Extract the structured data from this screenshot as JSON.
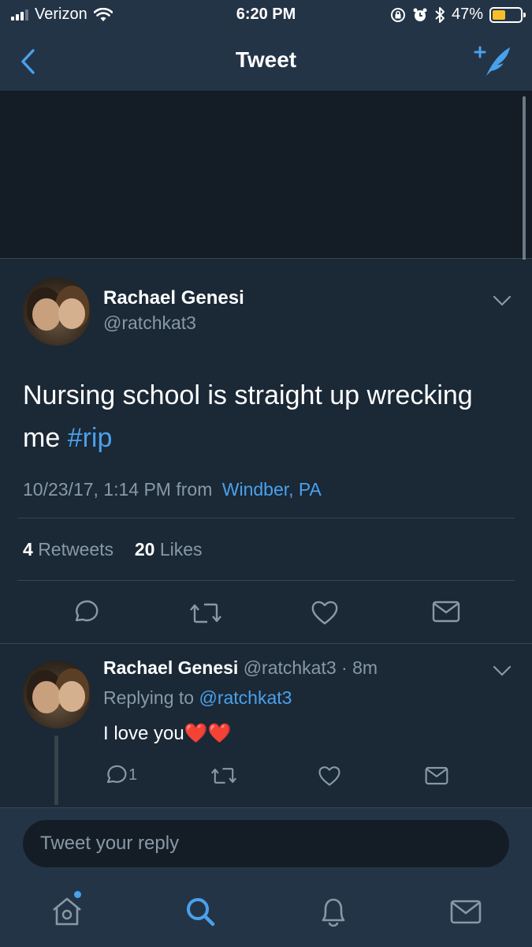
{
  "status_bar": {
    "carrier": "Verizon",
    "time": "6:20 PM",
    "battery": "47%",
    "battery_level": 0.47,
    "icons": [
      "signal-icon",
      "wifi-icon",
      "rotation-lock-icon",
      "alarm-icon",
      "bluetooth-icon",
      "battery-icon"
    ]
  },
  "nav": {
    "title": "Tweet",
    "back_icon": "back-chevron-icon",
    "compose_icon": "compose-tweet-icon"
  },
  "main_tweet": {
    "name": "Rachael Genesi",
    "handle": "@ratchkat3",
    "text": "Nursing school is straight up wrecking me",
    "hashtag": "#rip",
    "timestamp": "10/23/17, 1:14 PM from",
    "location": "Windber, PA",
    "retweets_count": "4",
    "retweets_label": "Retweets",
    "likes_count": "20",
    "likes_label": "Likes"
  },
  "reply_tweet": {
    "name": "Rachael Genesi",
    "handle_time": "@ratchkat3 · 8m",
    "replying_prefix": "Replying to",
    "replying_to": "@ratchkat3",
    "text": "I love you",
    "emoji": "❤️❤️",
    "reply_count": "1"
  },
  "reply_bar": {
    "placeholder": "Tweet your reply"
  },
  "tab_bar": {
    "tabs": [
      "home-icon",
      "search-icon",
      "notifications-icon",
      "messages-icon"
    ],
    "active": "search-icon"
  },
  "colors": {
    "accent": "#4aa1eb",
    "background": "#1b2836",
    "bar": "#243447",
    "muted": "#8899a6",
    "battery": "#f6c026"
  }
}
